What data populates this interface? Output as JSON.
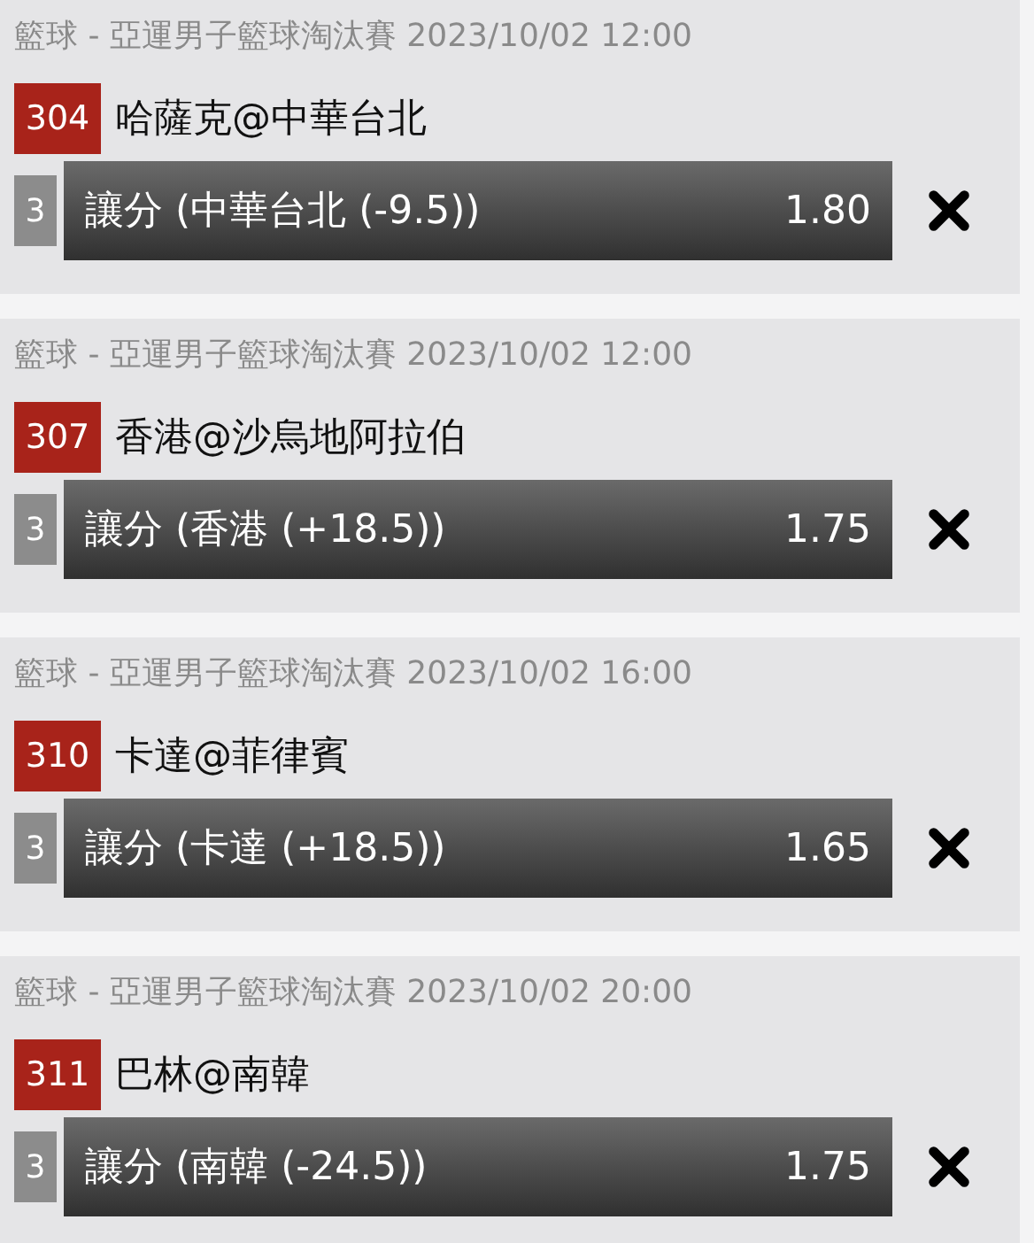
{
  "bets": [
    {
      "header": "籃球 - 亞運男子籃球淘汰賽 2023/10/02 12:00",
      "match_no": "304",
      "match": "哈薩克@中華台北",
      "count": "3",
      "selection": "讓分 (中華台北 (-9.5))",
      "odds": "1.80"
    },
    {
      "header": "籃球 - 亞運男子籃球淘汰賽 2023/10/02 12:00",
      "match_no": "307",
      "match": "香港@沙烏地阿拉伯",
      "count": "3",
      "selection": "讓分 (香港 (+18.5))",
      "odds": "1.75"
    },
    {
      "header": "籃球 - 亞運男子籃球淘汰賽 2023/10/02 16:00",
      "match_no": "310",
      "match": "卡達@菲律賓",
      "count": "3",
      "selection": "讓分 (卡達 (+18.5))",
      "odds": "1.65"
    },
    {
      "header": "籃球 - 亞運男子籃球淘汰賽 2023/10/02 20:00",
      "match_no": "311",
      "match": "巴林@南韓",
      "count": "3",
      "selection": "讓分 (南韓 (-24.5))",
      "odds": "1.75"
    }
  ]
}
